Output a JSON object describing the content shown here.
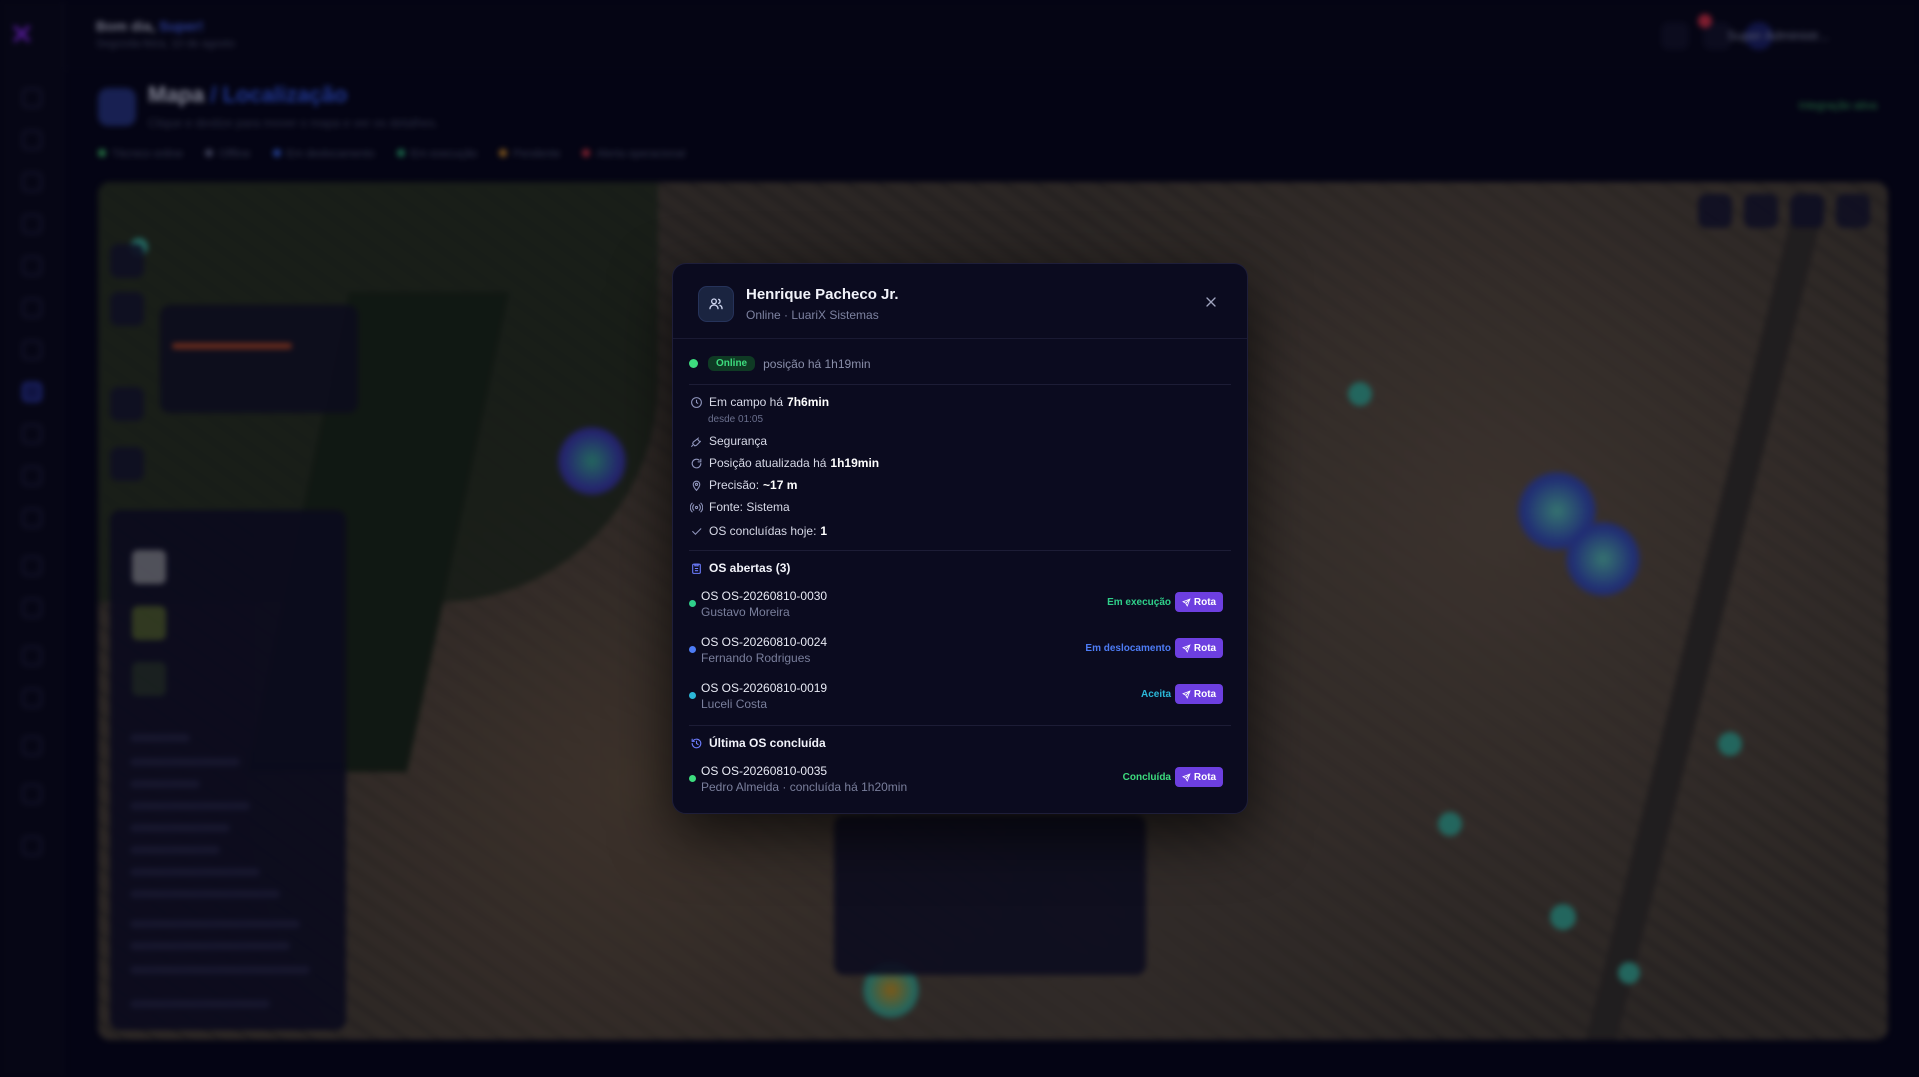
{
  "topbar": {
    "greeting_prefix": "Bom dia,",
    "greeting_name": "Super!",
    "greeting_sub": "Segunda-feira, 10 de agosto",
    "user_name": "Super Administr..."
  },
  "page": {
    "title": "Mapa",
    "title_sub": "/ Localização",
    "description": "Clique e deslize para mover o mapa e ver os detalhes.",
    "realtime_label": "Integração ativa"
  },
  "legend_top": [
    {
      "label": "Técnico online",
      "color": "#3fc46a"
    },
    {
      "label": "Offline",
      "color": "#6b7092"
    },
    {
      "label": "Em deslocamento",
      "color": "#3d6cf0"
    },
    {
      "label": "Em execução",
      "color": "#2fb57a"
    },
    {
      "label": "Pendente",
      "color": "#e0962a"
    },
    {
      "label": "Alerta operacional",
      "color": "#e23a4a"
    }
  ],
  "modal": {
    "title": "Henrique Pacheco Jr.",
    "subtitle": "Online · LuariX Sistemas",
    "status_pill": "Online",
    "status_text": "posição há 1h19min",
    "info": {
      "field_prefix": "Em campo há",
      "field_value": "7h6min",
      "since": "desde 01:05",
      "segment": "Segurança",
      "position_prefix": "Posição atualizada há",
      "position_value": "1h19min",
      "precision_prefix": "Precisão:",
      "precision_value": "~17 m",
      "source": "Fonte: Sistema",
      "done_prefix": "OS concluídas hoje:",
      "done_value": "1"
    },
    "open_os_title": "OS abertas (3)",
    "open_os": [
      {
        "code": "OS OS-20260810-0030",
        "client": "Gustavo Moreira",
        "status": "Em execução",
        "status_color": "#2fd08a",
        "dot_color": "#2fd08a",
        "action": "Rota"
      },
      {
        "code": "OS OS-20260810-0024",
        "client": "Fernando Rodrigues",
        "status": "Em deslocamento",
        "status_color": "#4d7cf5",
        "dot_color": "#4d7cf5",
        "action": "Rota"
      },
      {
        "code": "OS OS-20260810-0019",
        "client": "Luceli Costa",
        "status": "Aceita",
        "status_color": "#2bb8d8",
        "dot_color": "#2bb8d8",
        "action": "Rota"
      }
    ],
    "last_os_title": "Última OS concluída",
    "last_os": {
      "code": "OS OS-20260810-0035",
      "client": "Pedro Almeida · concluída há 1h20min",
      "status": "Concluída",
      "status_color": "#3ddc7e",
      "dot_color": "#3ddc7e",
      "action": "Rota"
    }
  },
  "colors": {
    "accent": "#6d3fe0",
    "online": "#3ddc7e",
    "background": "#07071a"
  },
  "icons": [
    "users-icon",
    "close-icon",
    "clock-icon",
    "wrench-icon",
    "refresh-icon",
    "pin-icon",
    "signal-icon",
    "check-icon",
    "clipboard-icon",
    "history-icon",
    "send-icon"
  ]
}
